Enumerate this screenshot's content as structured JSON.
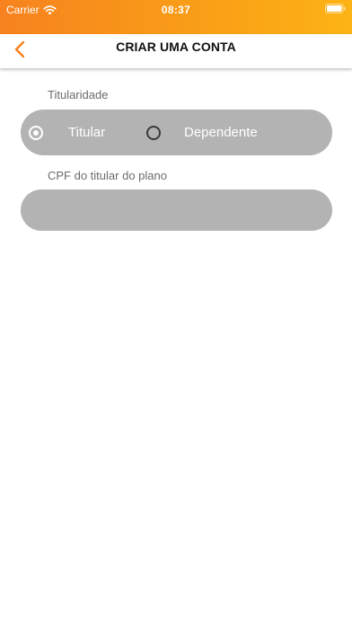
{
  "status_bar": {
    "carrier": "Carrier",
    "time": "08:37",
    "icons": [
      "wifi-icon",
      "battery-icon"
    ]
  },
  "nav": {
    "title": "CRIAR UMA CONTA",
    "back_icon": "chevron-left-icon"
  },
  "form": {
    "titularidade": {
      "label": "Titularidade",
      "options": [
        {
          "label": "Titular",
          "selected": true
        },
        {
          "label": "Dependente",
          "selected": false
        }
      ]
    },
    "cpf": {
      "label": "CPF do titular do plano",
      "value": "",
      "placeholder": ""
    }
  },
  "colors": {
    "accent": "#f7821f",
    "gradient_end": "#fcb314",
    "field_bg": "#b3b3b3",
    "label_text": "#6b6b6b"
  }
}
